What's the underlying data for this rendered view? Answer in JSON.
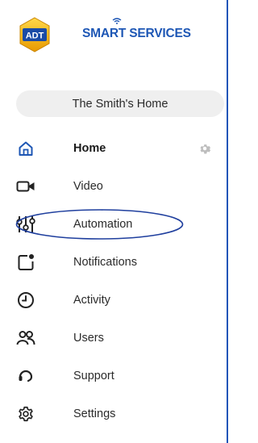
{
  "brand": {
    "logo_text": "ADT",
    "name": "SMART SERVICES",
    "colors": {
      "brand_blue": "#1e57b5",
      "logo_gold": "#f2b21b",
      "active_icon": "#1e57b5",
      "highlight": "#1f3f9e"
    }
  },
  "home_selector": {
    "label": "The Smith's Home"
  },
  "nav": {
    "items": [
      {
        "label": "Home",
        "icon": "home-icon",
        "active": true,
        "has_settings": true,
        "settings_icon": "gear-icon"
      },
      {
        "label": "Video",
        "icon": "video-camera-icon",
        "active": false
      },
      {
        "label": "Automation",
        "icon": "automation-sliders-icon",
        "active": false,
        "highlighted": true
      },
      {
        "label": "Notifications",
        "icon": "notification-icon",
        "active": false
      },
      {
        "label": "Activity",
        "icon": "clock-icon",
        "active": false
      },
      {
        "label": "Users",
        "icon": "users-icon",
        "active": false
      },
      {
        "label": "Support",
        "icon": "support-headset-icon",
        "active": false
      },
      {
        "label": "Settings",
        "icon": "settings-gear-icon",
        "active": false
      }
    ]
  }
}
